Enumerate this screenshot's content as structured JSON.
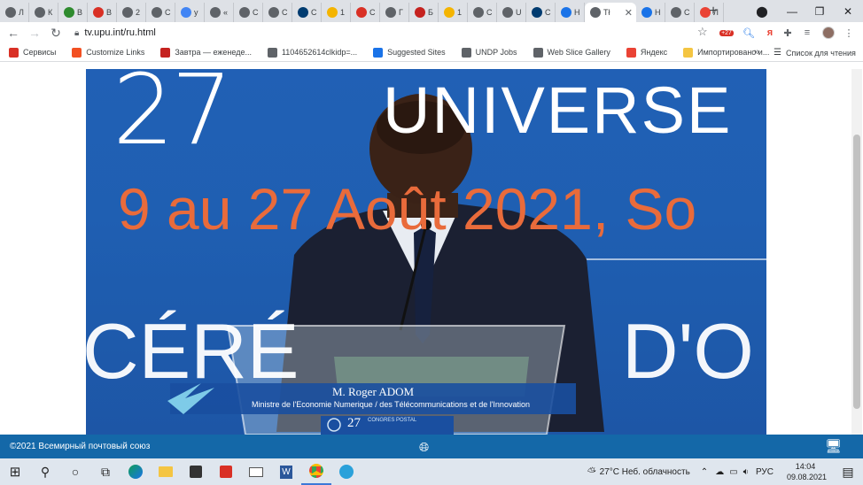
{
  "tabs": [
    {
      "label": "Л",
      "icon": "circle-icon",
      "color": "#5f6368"
    },
    {
      "label": "К",
      "icon": "circle-icon",
      "color": "#5f6368"
    },
    {
      "label": "В",
      "icon": "kgs-icon",
      "color": "#2e8b2e"
    },
    {
      "label": "В",
      "icon": "gmail-icon",
      "color": "#d93025"
    },
    {
      "label": "2",
      "icon": "circle-icon",
      "color": "#5f6368"
    },
    {
      "label": "С",
      "icon": "circle-icon",
      "color": "#5f6368"
    },
    {
      "label": "у",
      "icon": "dots-icon",
      "color": "#4285f4"
    },
    {
      "label": "«",
      "icon": "circle-icon",
      "color": "#5f6368"
    },
    {
      "label": "С",
      "icon": "circle-icon",
      "color": "#5f6368"
    },
    {
      "label": "С",
      "icon": "circle-icon",
      "color": "#5f6368"
    },
    {
      "label": "С",
      "icon": "citi-icon",
      "color": "#003b70"
    },
    {
      "label": "1",
      "icon": "mail-icon",
      "color": "#f4b400"
    },
    {
      "label": "С",
      "icon": "redbox-icon",
      "color": "#d93025"
    },
    {
      "label": "Г",
      "icon": "circle-icon",
      "color": "#5f6368"
    },
    {
      "label": "Б",
      "icon": "z-icon",
      "color": "#c5221f"
    },
    {
      "label": "1",
      "icon": "mail-icon",
      "color": "#f4b400"
    },
    {
      "label": "С",
      "icon": "circle-icon",
      "color": "#5f6368"
    },
    {
      "label": "U",
      "icon": "circle-icon",
      "color": "#5f6368"
    },
    {
      "label": "С",
      "icon": "citi-icon",
      "color": "#003b70"
    },
    {
      "label": "Н",
      "icon": "un-icon",
      "color": "#1a73e8"
    },
    {
      "label": "Tł",
      "icon": "upu-icon",
      "color": "#5f6368",
      "active": true
    },
    {
      "label": "Н",
      "icon": "un-icon",
      "color": "#1a73e8"
    },
    {
      "label": "С",
      "icon": "circle-icon",
      "color": "#5f6368"
    },
    {
      "label": "Л",
      "icon": "g-icon",
      "color": "#ea4335"
    }
  ],
  "toolbar": {
    "url": "tv.upu.int/ru.html",
    "ext_badge": "+27"
  },
  "bookmarks": [
    {
      "label": "Сервисы",
      "color": "#d93025"
    },
    {
      "label": "Customize Links",
      "color": "#f25022"
    },
    {
      "label": "Завтра — еженеде...",
      "color": "#c5221f"
    },
    {
      "label": "1104652614clkidp=...",
      "color": "#5f6368"
    },
    {
      "label": "Suggested Sites",
      "color": "#1a73e8"
    },
    {
      "label": "UNDP Jobs",
      "color": "#5f6368"
    },
    {
      "label": "Web Slice Gallery",
      "color": "#5f6368"
    },
    {
      "label": "Яндекс",
      "color": "#ea4335"
    },
    {
      "label": "Импортировано и...",
      "color": "#f4c542"
    }
  ],
  "bookmarks_more": "»",
  "reading_list": "Список для чтения",
  "video": {
    "line1": "27",
    "line1b": "UNIVERSE",
    "line2": "9 au 27 Août 2021, So",
    "line3a": "CÉRÉ",
    "line3b": "D'O",
    "caption_name": "M. Roger ADOM",
    "caption_title": "Ministre de l'Economie Numerique / des Télécommunications et de l'Innovation",
    "podium_logo": "27",
    "podium_text": "CONGRES POSTAL",
    "sky": "#1f5fb2",
    "accent": "#e96b3b"
  },
  "footer": {
    "copyright": "©2021 Всемирный почтовый союз"
  },
  "taskbar": {
    "weather": "27°C  Неб. облачность",
    "lang": "РУС",
    "time": "14:04",
    "date": "09.08.2021"
  }
}
